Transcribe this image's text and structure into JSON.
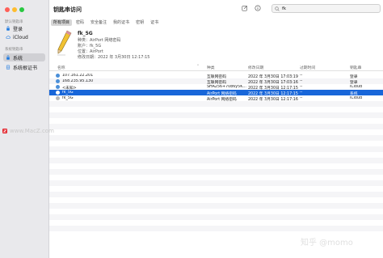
{
  "colors": {
    "accent": "#1866d9",
    "close": "#ff5f57",
    "minimize": "#febc2e",
    "zoom": "#28c840"
  },
  "window": {
    "title": "钥匙串访问"
  },
  "sidebar": {
    "section1": "默认钥匙串",
    "items1": [
      {
        "label": "登录",
        "icon": "lock-icon"
      },
      {
        "label": "iCloud",
        "icon": "cloud-icon"
      }
    ],
    "section2": "系统钥匙串",
    "items2": [
      {
        "label": "系统",
        "icon": "lock-icon",
        "selected": true
      },
      {
        "label": "系统根证书",
        "icon": "cabinet-icon"
      }
    ]
  },
  "toolbar": {
    "search_value": "fk"
  },
  "tabs": [
    "所有项目",
    "密码",
    "安全备注",
    "我的证书",
    "密钥",
    "证书"
  ],
  "detail": {
    "name": "fk_5G",
    "kind": "种类：AirPort 网络密码",
    "account": "账户：fk_5G",
    "where": "位置：AirPort",
    "modified": "修改日期：2022 年 3月30日 12:17:15"
  },
  "table": {
    "headers": {
      "name": "名称",
      "kind": "种类",
      "modified": "修改日期",
      "expires": "过期时间",
      "keychain": "钥匙串"
    },
    "rows": [
      {
        "name": "107.161.22.201",
        "kind": "互联网密码",
        "modified": "2022 年 3月30日 17:03:19",
        "expires": "--",
        "keychain": "登录"
      },
      {
        "name": "168.235.95.130",
        "kind": "互联网密码",
        "modified": "2022 年 3月30日 17:03:16",
        "expires": "--",
        "keychain": "登录"
      },
      {
        "name": "<未知>",
        "kind": "SHA256+70b6y5K...",
        "modified": "2022 年 3月30日 12:17:15",
        "expires": "--",
        "keychain": "iCloud"
      },
      {
        "name": "fk_5G",
        "kind": "AirPort 网络密码",
        "modified": "2022 年 3月30日 12:17:15",
        "expires": "--",
        "keychain": "系统",
        "selected": true
      },
      {
        "name": "fk_5G",
        "kind": "AirPort 网络密码",
        "modified": "2022 年 3月30日 12:17:16",
        "expires": "--",
        "keychain": "iCloud"
      }
    ]
  },
  "watermarks": {
    "mac": "www.MacZ.com",
    "zhihu": "知乎 @momo"
  }
}
